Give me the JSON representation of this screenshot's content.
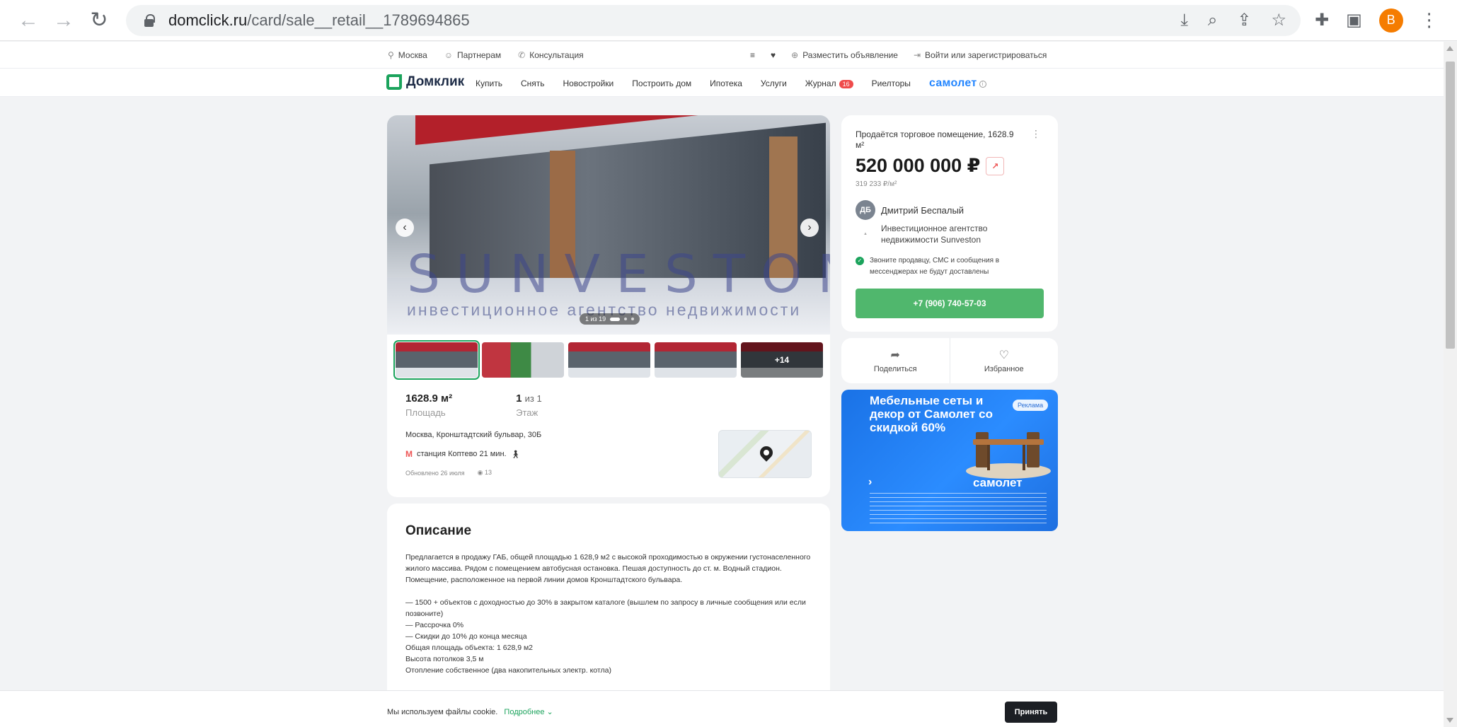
{
  "browser": {
    "url_host": "domclick.ru",
    "url_path": "/card/sale__retail__1789694865",
    "profile_initial": "B"
  },
  "util": {
    "city": "Москва",
    "partners": "Партнерам",
    "consult": "Консультация",
    "post_ad": "Разместить объявление",
    "login": "Войти или зарегистрироваться"
  },
  "nav": {
    "logo": "Домклик",
    "links": [
      "Купить",
      "Снять",
      "Новостройки",
      "Построить дом",
      "Ипотека",
      "Услуги",
      "Журнал",
      "Риелторы"
    ],
    "journal_badge": "16",
    "brand": "самолет"
  },
  "gallery": {
    "watermark_main": "SUNVESTON",
    "watermark_sub": "инвестиционное агентство недвижимости",
    "counter": "1 из 19",
    "more": "+14"
  },
  "facts": {
    "area_value": "1628.9 м²",
    "area_label": "Площадь",
    "floor_value": "1",
    "floor_of": "из 1",
    "floor_label": "Этаж"
  },
  "location": {
    "address": "Москва, Кронштадтский бульвар, 30Б",
    "metro_icon": "М",
    "metro": "станция Коптево 21 мин.",
    "updated": "Обновлено 26 июля",
    "views": "13"
  },
  "description": {
    "title": "Описание",
    "p1": "Предлагается в продажу ГАБ, общей площадью 1 628,9 м2 с высокой проходимостью в окружении густонаселенного жилого массива. Рядом с помещением автобусная остановка. Пешая доступность до ст. м. Водный стадион.",
    "p2": "Помещение, расположенное на первой линии домов Кронштадтского бульвара.",
    "l1": "— 1500 + объектов с доходностью до 30% в закрытом каталоге (вышлем по запросу в личные сообщения или если позвоните)",
    "l2": "— Рассрочка 0%",
    "l3": "— Скидки до 10% до конца месяца",
    "l4": "Общая площадь объекта: 1 628,9 м2",
    "l5": "Высота потолков 3,5 м",
    "l6": "Отопление собственное (два накопительных электр. котла)"
  },
  "offer": {
    "title": "Продаётся торговое помещение, 1628.9 м²",
    "price": "520 000 000 ₽",
    "per_sqm": "319 233 ₽/м²",
    "seller_initials": "ДБ",
    "seller_name": "Дмитрий Беспалый",
    "agency": "Инвестиционное агентство недвижимости Sunveston",
    "notice": "Звоните продавцу, СМС и сообщения в мессенджерах не будут доставлены",
    "phone": "+7 (906) 740-57-03"
  },
  "actions": {
    "share": "Поделиться",
    "favorite": "Избранное"
  },
  "ad": {
    "title": "Мебельные сеты и декор от Самолет со скидкой 60%",
    "badge": "Реклама",
    "brand": "самолет"
  },
  "cookie": {
    "text": "Мы используем файлы cookie.",
    "more": "Подробнее",
    "accept": "Принять"
  }
}
